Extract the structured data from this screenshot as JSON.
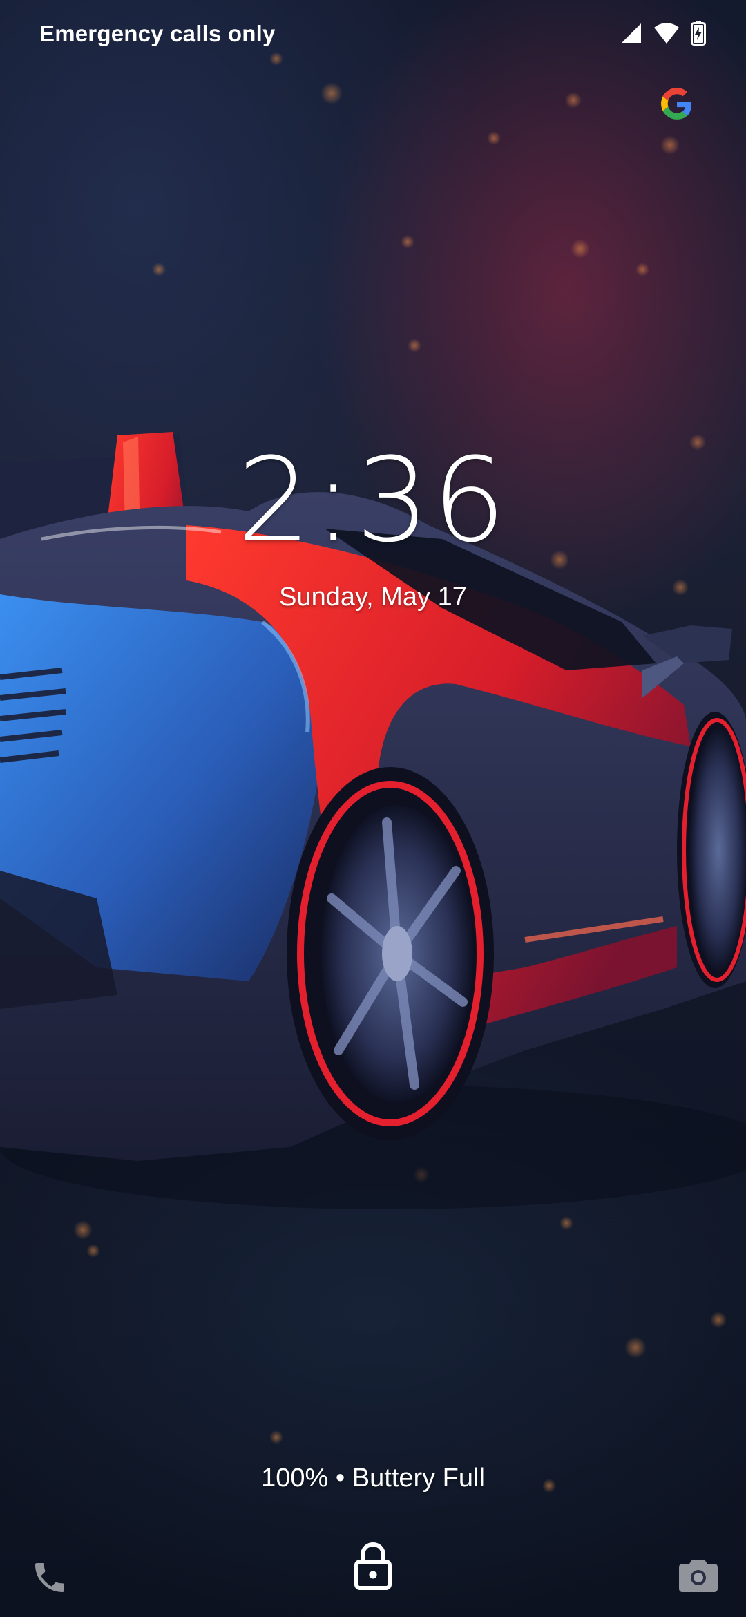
{
  "status_bar": {
    "carrier_text": "Emergency calls only",
    "icons": [
      "signal-icon",
      "wifi-icon",
      "battery-charging-icon"
    ]
  },
  "lockscreen": {
    "time": "2:36",
    "date": "Sunday, May 17",
    "battery_status": "100% • Buttery Full"
  },
  "shortcuts": {
    "left": "phone-icon",
    "center": "lock-icon",
    "right": "camera-icon"
  },
  "colors": {
    "text": "#ffffff",
    "accent_red": "#e8232e",
    "accent_blue": "#2f7fe0"
  }
}
